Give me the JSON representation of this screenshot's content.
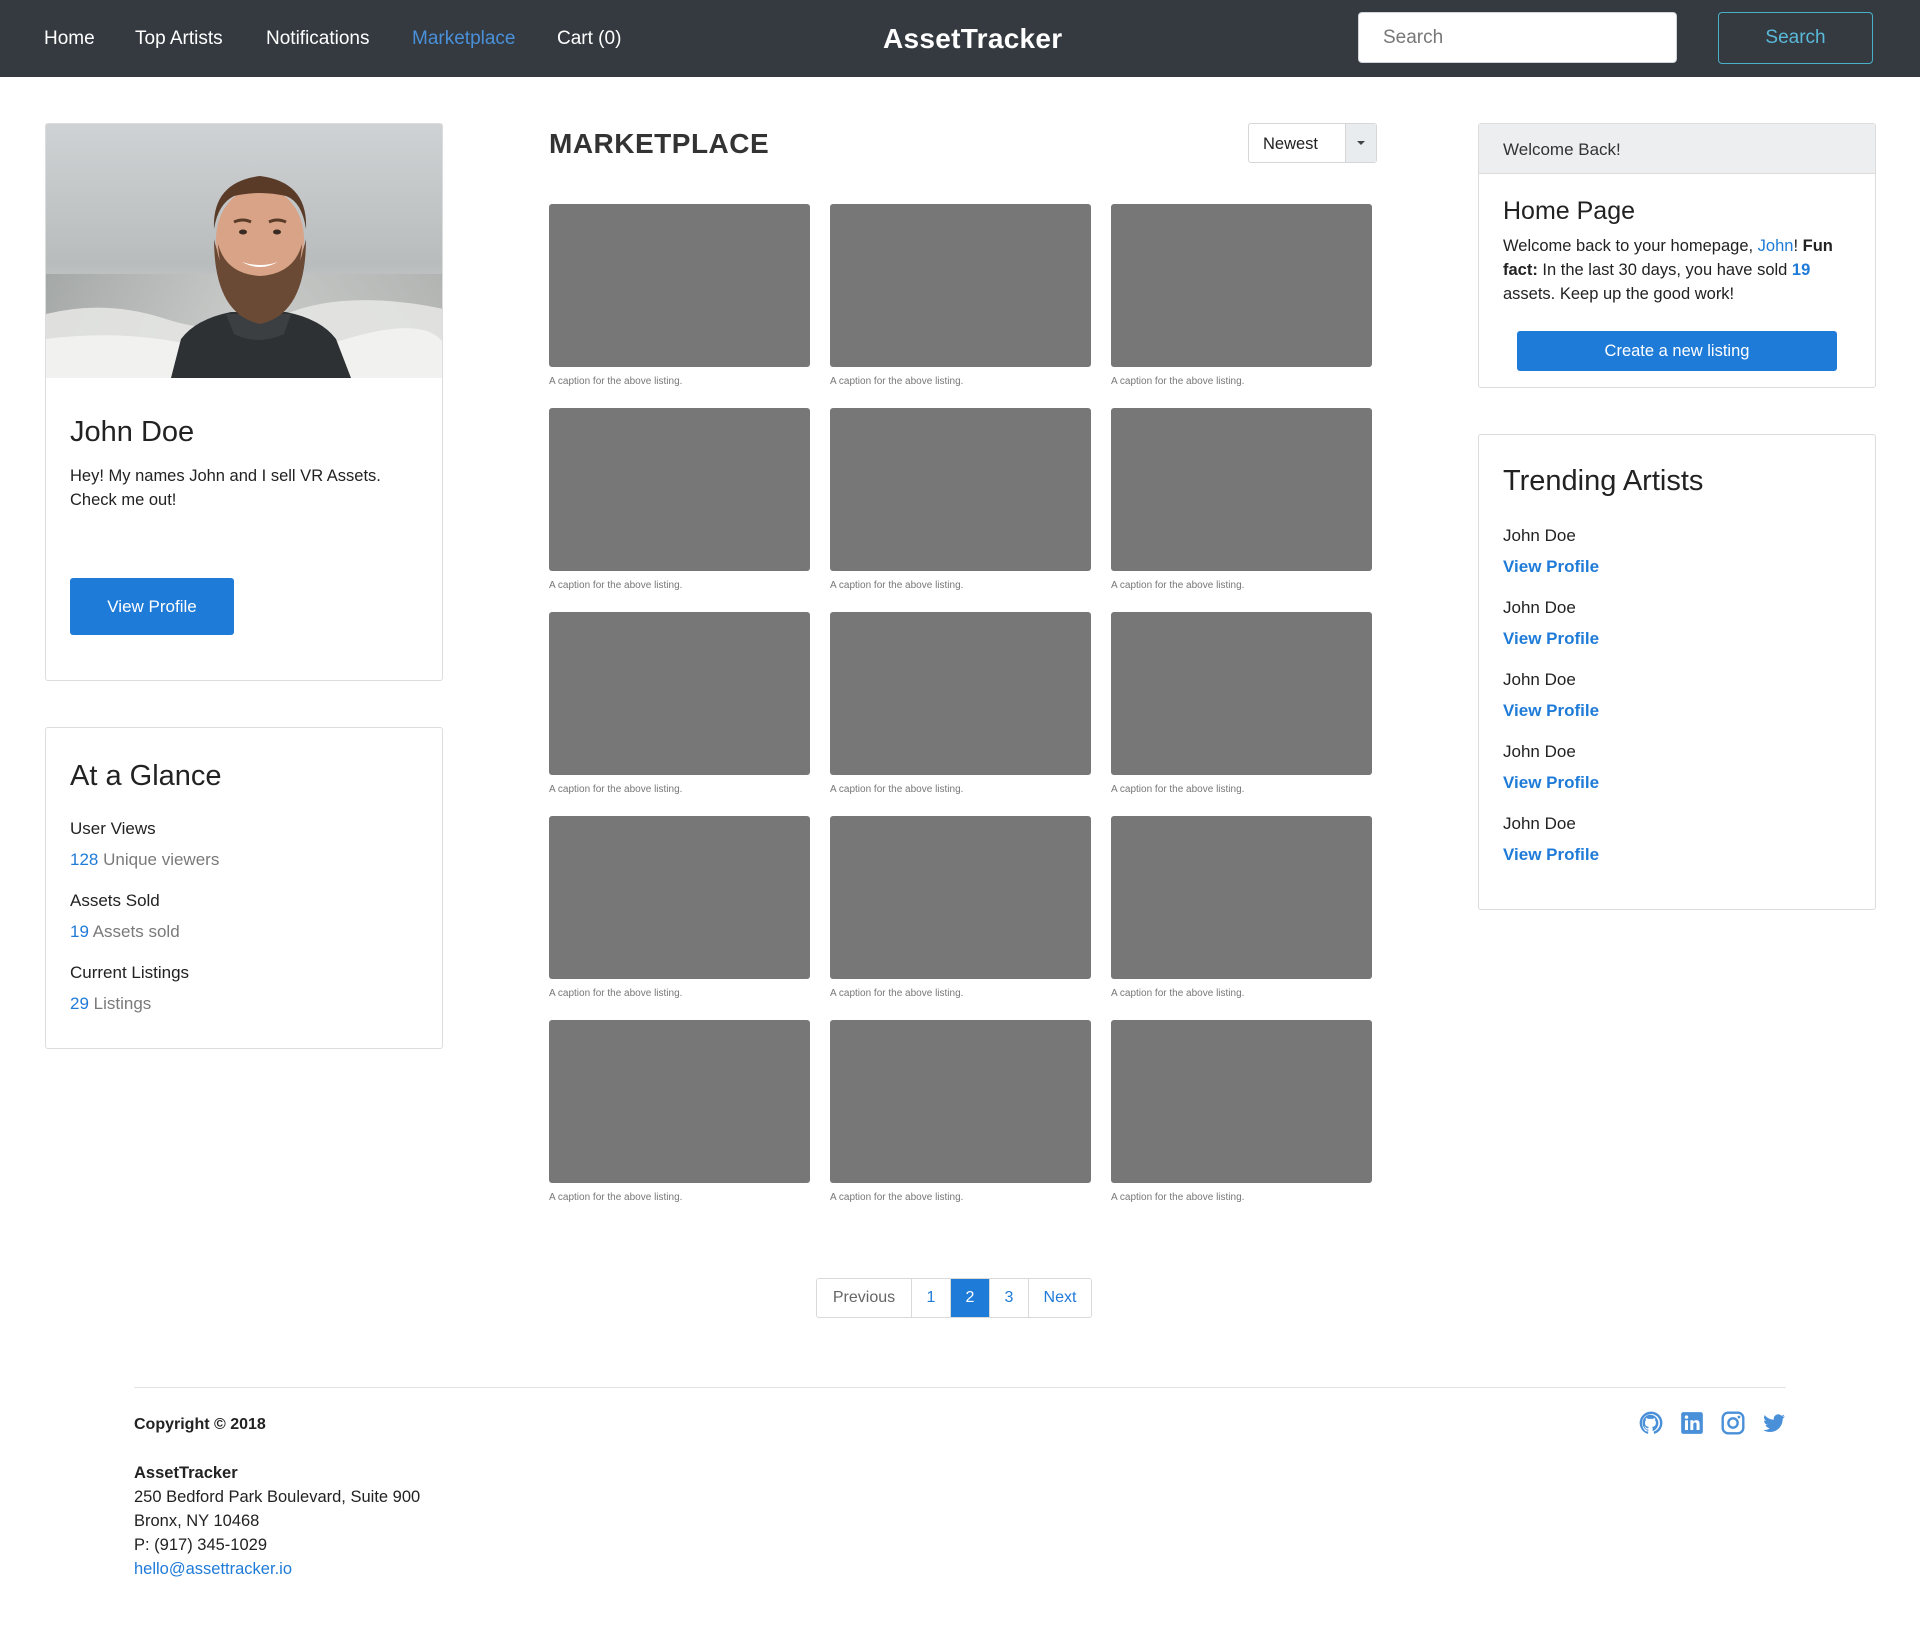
{
  "nav": {
    "links": [
      "Home",
      "Top Artists",
      "Notifications",
      "Marketplace",
      "Cart (0)"
    ],
    "active": "Marketplace",
    "brand": "AssetTracker",
    "search_placeholder": "Search",
    "search_button": "Search"
  },
  "profile": {
    "name": "John Doe",
    "bio": "Hey! My names John and I sell VR Assets. Check me out!",
    "view_profile": "View Profile"
  },
  "glance": {
    "title": "At a Glance",
    "stats": [
      {
        "label": "User Views",
        "value": "128",
        "unit": "Unique viewers"
      },
      {
        "label": "Assets Sold",
        "value": "19",
        "unit": "Assets sold"
      },
      {
        "label": "Current Listings",
        "value": "29",
        "unit": "Listings"
      }
    ]
  },
  "marketplace": {
    "title": "MARKETPLACE",
    "sort": "Newest",
    "caption": "A caption for the above listing.",
    "listing_count": 15
  },
  "pagination": {
    "previous": "Previous",
    "pages": [
      "1",
      "2",
      "3"
    ],
    "current": "2",
    "next": "Next"
  },
  "welcome": {
    "header": "Welcome Back!",
    "title": "Home Page",
    "text_1": "Welcome back to your homepage, ",
    "user": "John",
    "text_2": "! ",
    "fun_fact": "Fun fact:",
    "text_3": " In the last 30 days, you have sold ",
    "sold": "19",
    "text_4": " assets. Keep up the good work!",
    "button": "Create a new listing"
  },
  "trending": {
    "title": "Trending Artists",
    "artists": [
      {
        "name": "John Doe",
        "link": "View Profile"
      },
      {
        "name": "John Doe",
        "link": "View Profile"
      },
      {
        "name": "John Doe",
        "link": "View Profile"
      },
      {
        "name": "John Doe",
        "link": "View Profile"
      },
      {
        "name": "John Doe",
        "link": "View Profile"
      }
    ]
  },
  "footer": {
    "copyright": "Copyright © 2018",
    "company": "AssetTracker",
    "address_1": "250 Bedford Park Boulevard, Suite 900",
    "address_2": "Bronx, NY 10468",
    "phone": "P: (917) 345-1029",
    "email": "hello@assettracker.io",
    "social_icons": [
      "github-icon",
      "linkedin-icon",
      "instagram-icon",
      "twitter-icon"
    ]
  },
  "colors": {
    "navbar": "#343a40",
    "primary": "#1f7bd8",
    "nav_active": "#4a90d9",
    "placeholder": "#777777"
  }
}
